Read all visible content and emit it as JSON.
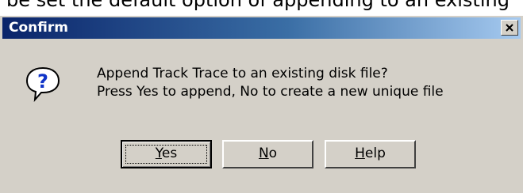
{
  "background_text": "be set the default option of appending to an existing",
  "dialog": {
    "title": "Confirm",
    "close_glyph": "close-icon",
    "icon": "question-icon",
    "message": {
      "line1": "Append Track Trace to an existing disk file?",
      "line2": "Press Yes to append, No to create a new unique file"
    },
    "buttons": {
      "yes": {
        "accel": "Y",
        "rest": "es"
      },
      "no": {
        "accel": "N",
        "rest": "o"
      },
      "help": {
        "accel": "H",
        "rest": "elp"
      }
    }
  },
  "colors": {
    "title_start": "#0a246a",
    "title_end": "#a6caf0",
    "face": "#d4d0c8"
  }
}
